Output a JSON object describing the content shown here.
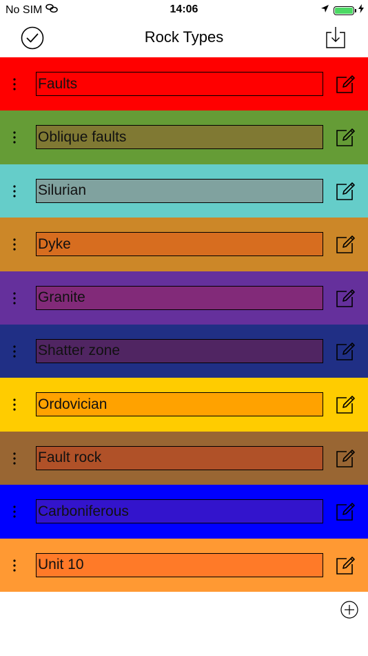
{
  "status_bar": {
    "carrier": "No SIM",
    "time": "14:06",
    "battery_color": "#4cd964",
    "icons": [
      "link-icon",
      "location-arrow-icon",
      "battery-icon",
      "charging-bolt-icon"
    ]
  },
  "nav": {
    "title": "Rock Types",
    "left_icon": "checkmark-circle-icon",
    "right_icon": "download-tray-icon"
  },
  "rock_types": [
    {
      "name": "Faults",
      "color": "#ff0000",
      "field_color": "#ff0000"
    },
    {
      "name": "Oblique faults",
      "color": "#659c36",
      "field_color": "#807933"
    },
    {
      "name": "Silurian",
      "color": "#65cdc9",
      "field_color": "#80a29f"
    },
    {
      "name": "Dyke",
      "color": "#cc8728",
      "field_color": "#d76d1f"
    },
    {
      "name": "Granite",
      "color": "#65309c",
      "field_color": "#822a79"
    },
    {
      "name": "Shatter zone",
      "color": "#202f85",
      "field_color": "#502562"
    },
    {
      "name": "Ordovician",
      "color": "#ffcc00",
      "field_color": "#ffa200"
    },
    {
      "name": "Fault rock",
      "color": "#996633",
      "field_color": "#b05128"
    },
    {
      "name": "Carboniferous",
      "color": "#0000ff",
      "field_color": "#3314cc"
    },
    {
      "name": "Unit 10",
      "color": "#ff9933",
      "field_color": "#ff7a28"
    }
  ],
  "row_icons": {
    "handle": "drag-handle-icon",
    "edit": "edit-icon"
  },
  "footer": {
    "add_icon": "add-circle-icon"
  }
}
